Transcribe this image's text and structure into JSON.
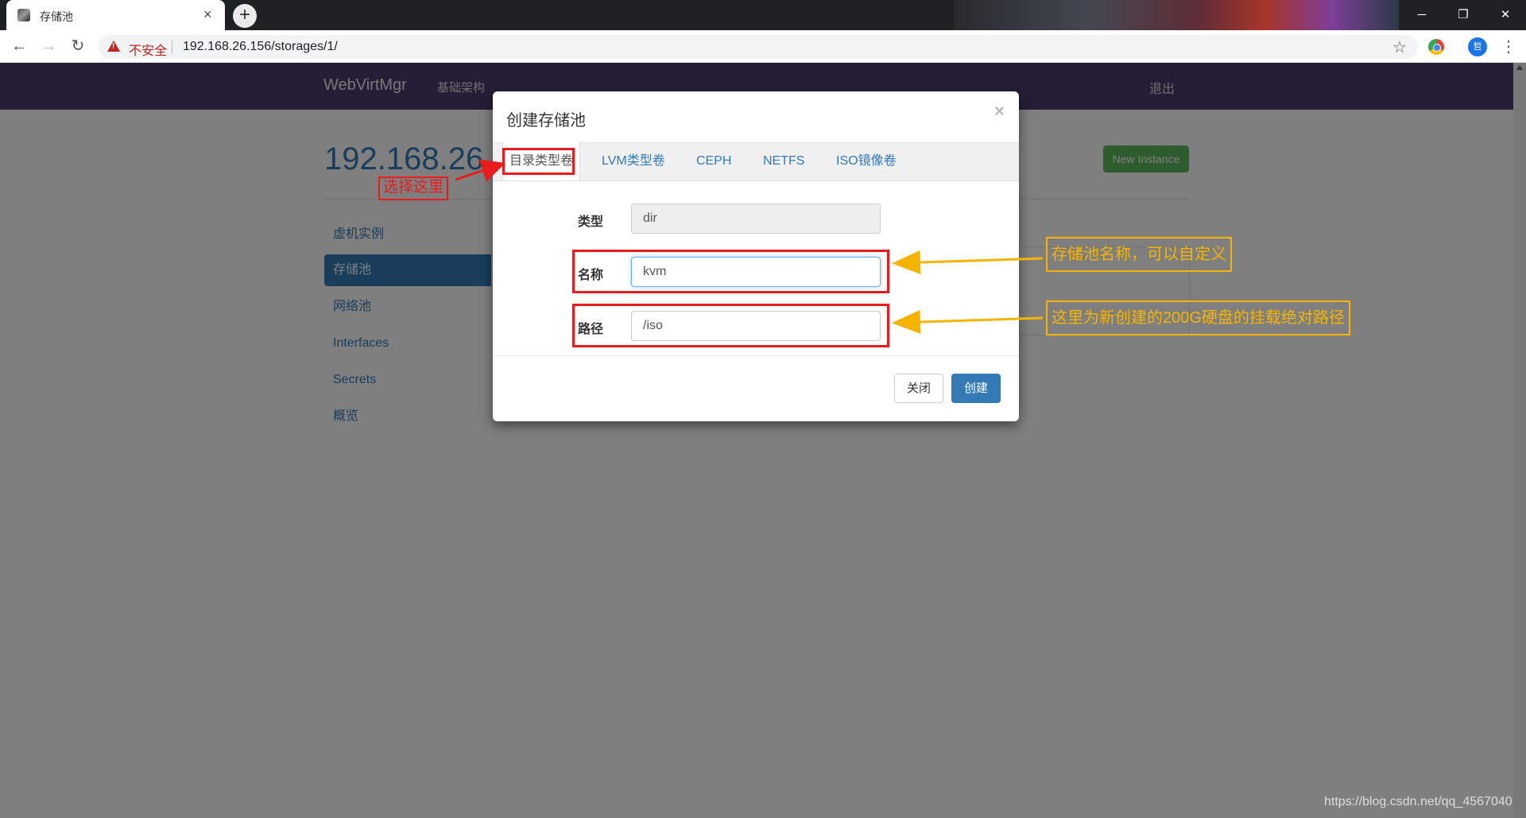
{
  "browser": {
    "tab_title": "存储池",
    "tab_close": "×",
    "new_tab": "+",
    "minimize": "─",
    "restore": "❐",
    "close": "✕",
    "security_label": "不安全",
    "url": "192.168.26.156/storages/1/",
    "profile_initial": "哲"
  },
  "app": {
    "brand": "WebVirtMgr",
    "nav_infrastructure": "基础架构",
    "logout": "退出",
    "hostname": "192.168.26",
    "new_instance": "New Instance",
    "sidebar": [
      {
        "label": "虚机实例"
      },
      {
        "label": "存储池"
      },
      {
        "label": "网络池"
      },
      {
        "label": "Interfaces"
      },
      {
        "label": "Secrets"
      },
      {
        "label": "概览"
      }
    ],
    "active_sidebar_index": 1
  },
  "modal": {
    "title": "创建存储池",
    "close": "×",
    "tabs": [
      {
        "label": "目录类型卷"
      },
      {
        "label": "LVM类型卷"
      },
      {
        "label": "CEPH"
      },
      {
        "label": "NETFS"
      },
      {
        "label": "ISO镜像卷"
      }
    ],
    "active_tab_index": 0,
    "fields": {
      "type_label": "类型",
      "type_value": "dir",
      "name_label": "名称",
      "name_value": "kvm",
      "path_label": "路径",
      "path_value": "/iso"
    },
    "buttons": {
      "close": "关闭",
      "create": "创建"
    }
  },
  "annotations": {
    "select_here": "选择这里",
    "name_note": "存储池名称，可以自定义",
    "path_note": "这里为新创建的200G硬盘的挂载绝对路径"
  },
  "watermark": "https://blog.csdn.net/qq_4567040",
  "colors": {
    "navbar": "#4c3d6e",
    "primary": "#337ab7",
    "success": "#5cb85c",
    "annotation_red": "#e81c1c",
    "annotation_yellow": "#f5b400"
  }
}
